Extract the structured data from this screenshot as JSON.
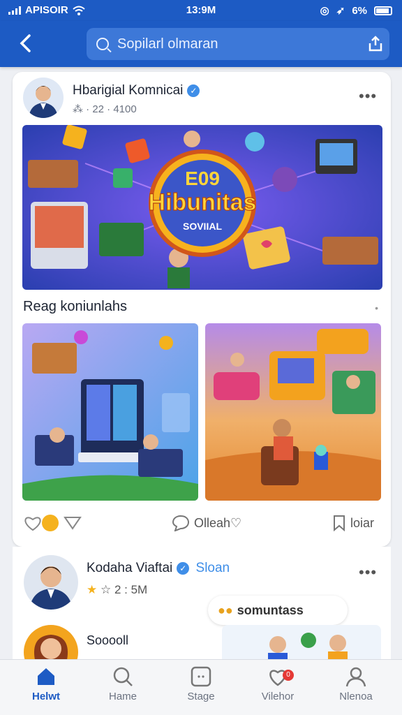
{
  "status_bar": {
    "carrier": "APISOIR",
    "time": "13:9M",
    "battery": "6%"
  },
  "search": {
    "placeholder": "Sopilarl olmaran"
  },
  "post": {
    "author": "Hbarigial Komnicai",
    "meta": "⁂ · 22 · 4100",
    "hero_title": "Hibunitas",
    "hero_top": "E09",
    "hero_sub": "SOVIIAL",
    "section_title": "Reag koniunlahs",
    "actions": {
      "comment_label": "Olleah♡",
      "share_label": "loiar"
    }
  },
  "post2": {
    "author": "Kodaha Viaftai",
    "follow_label": "Sloan",
    "meta": "2 : 5M",
    "bubble_text": "somuntass",
    "commenter": "Sooooll"
  },
  "nav": {
    "items": [
      {
        "label": "Helwt"
      },
      {
        "label": "Hame"
      },
      {
        "label": "Stage"
      },
      {
        "label": "Vilehor",
        "badge": "0"
      },
      {
        "label": "Nlenoa"
      }
    ]
  },
  "colors": {
    "brand": "#1d5bc4",
    "accent": "#3f8ee8"
  }
}
